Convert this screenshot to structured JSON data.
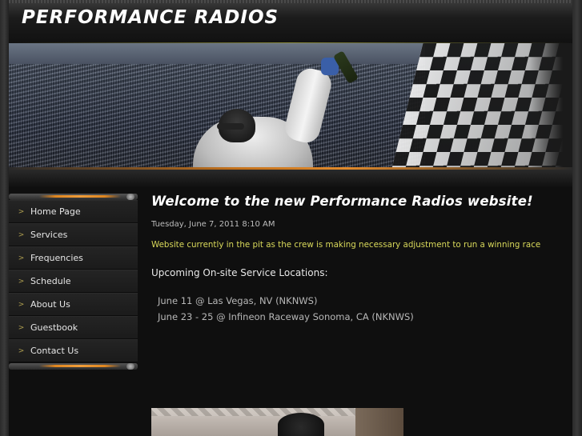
{
  "site": {
    "title": "PERFORMANCE RADIOS"
  },
  "sidebar": {
    "items": [
      {
        "label": "Home Page"
      },
      {
        "label": "Services"
      },
      {
        "label": "Frequencies"
      },
      {
        "label": "Schedule"
      },
      {
        "label": "About Us"
      },
      {
        "label": "Guestbook"
      },
      {
        "label": "Contact Us"
      }
    ],
    "chevron": ">"
  },
  "main": {
    "heading": "Welcome to the new Performance Radios website!",
    "date": "Tuesday, June 7, 2011 8:10 AM",
    "notice": "Website currently in the pit as the crew is making necessary adjustment to run a winning race",
    "upcoming_title": "Upcoming On-site Service Locations:",
    "locations": [
      "June 11 @ Las Vegas, NV (NKNWS)",
      "June 23 - 25 @ Infineon Raceway Sonoma, CA  (NKNWS)"
    ]
  },
  "colors": {
    "notice": "#d8d85a",
    "accent_orange": "#e0861f",
    "background": "#0f0f0f"
  }
}
